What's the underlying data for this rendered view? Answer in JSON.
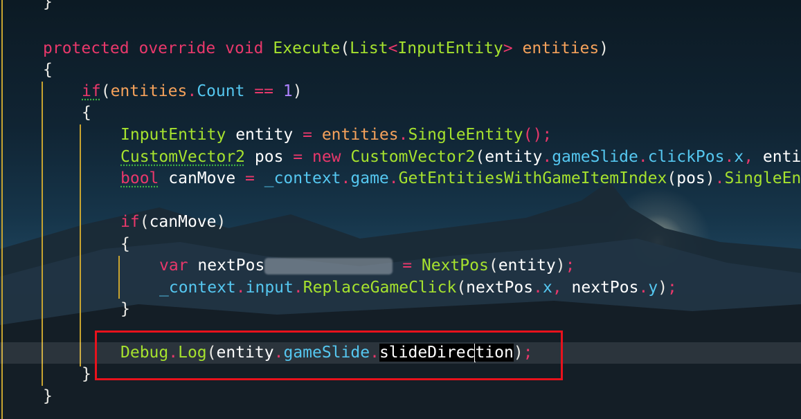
{
  "editor": {
    "lines": {
      "l0": {
        "brace": "}"
      },
      "l1": {
        "kw_protected": "protected",
        "kw_override": "override",
        "kw_void": "void",
        "method": "Execute",
        "paren_open": "(",
        "type_list": "List",
        "lt": "<",
        "type_entity": "InputEntity",
        "gt": ">",
        "param": "entities",
        "paren_close": ")"
      },
      "l2": {
        "brace": "{"
      },
      "l3": {
        "kw_if": "if",
        "p1": "(",
        "var": "entities",
        "dot": ".",
        "member": "Count",
        "op": " == ",
        "num": "1",
        "p2": ")"
      },
      "l4": {
        "brace": "{"
      },
      "l5": {
        "type": "InputEntity",
        "name": "entity",
        "eq": " = ",
        "obj": "entities",
        "dot": ".",
        "call": "SingleEntity",
        "rest": "();"
      },
      "l6": {
        "type": "CustomVector2",
        "name": "pos",
        "eq": " = ",
        "kw_new": "new",
        "ctor": "CustomVector2",
        "p1": "(",
        "obj": "entity",
        "d1": ".",
        "m1": "gameSlide",
        "d2": ".",
        "m2": "clickPos",
        "d3": ".",
        "m3": "x",
        "comma": ", ",
        "tail": "enti"
      },
      "l7": {
        "kw_bool": "bool",
        "name": "canMove",
        "eq": " = ",
        "ctx": "_context",
        "d1": ".",
        "m1": "game",
        "d2": ".",
        "call": "GetEntitiesWithGameItemIndex",
        "p1": "(",
        "arg": "pos",
        "p2": ")",
        "d3": ".",
        "tail": "SingleEn"
      },
      "l9": {
        "kw_if": "if",
        "p1": "(",
        "var": "canMove",
        "p2": ")"
      },
      "l10": {
        "brace": "{"
      },
      "l11": {
        "kw_var": "var",
        "name": "nextPos",
        "eq": " = ",
        "call": "NextPos",
        "p1": "(",
        "arg": "entity",
        "p2": ")",
        "semi": ";"
      },
      "l12": {
        "ctx": "_context",
        "d1": ".",
        "m1": "input",
        "d2": ".",
        "call": "ReplaceGameClick",
        "p1": "(",
        "a1": "nextPos",
        "d3": ".",
        "x": "x",
        "comma": ", ",
        "a2": "nextPos",
        "d4": ".",
        "y": "y",
        "p2": ")",
        "semi": ";"
      },
      "l13": {
        "brace": "}"
      },
      "l15": {
        "cls": "Debug",
        "d1": ".",
        "call": "Log",
        "p1": "(",
        "obj": "entity",
        "d2": ".",
        "m1": "gameSlide",
        "d3": ".",
        "sel_a": "slideDirec",
        "sel_b": "tion",
        "p2": ")",
        "semi": ";"
      },
      "l16": {
        "brace": "}"
      },
      "l17": {
        "brace": "}"
      }
    }
  },
  "theme": {
    "keyword": "#e9386b",
    "type": "#a6e22e",
    "param": "#f6a25b",
    "member": "#55c7f0",
    "number": "#ae81ff",
    "highlight_box": "#e8121c",
    "indent_guide": "#c8a430"
  }
}
